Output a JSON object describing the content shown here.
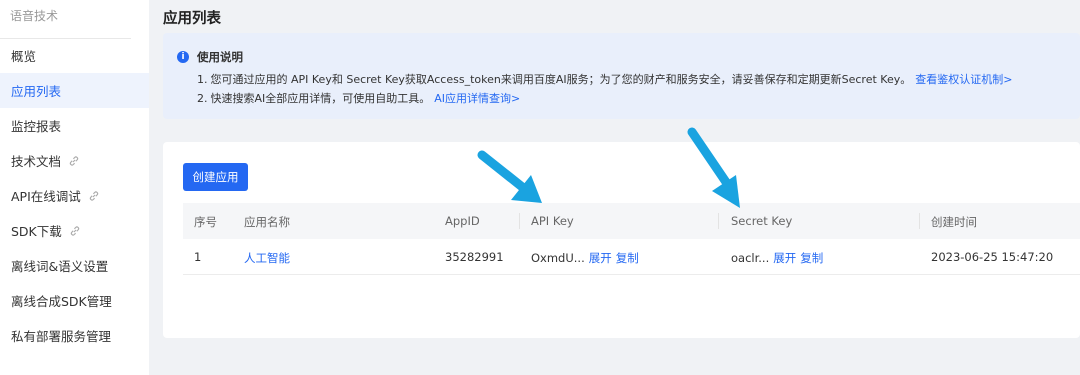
{
  "sidebar": {
    "header": "语音技术",
    "items": [
      {
        "label": "概览",
        "external": false,
        "active": false
      },
      {
        "label": "应用列表",
        "external": false,
        "active": true
      },
      {
        "label": "监控报表",
        "external": false,
        "active": false
      },
      {
        "label": "技术文档",
        "external": true,
        "active": false
      },
      {
        "label": "API在线调试",
        "external": true,
        "active": false
      },
      {
        "label": "SDK下载",
        "external": true,
        "active": false
      },
      {
        "label": "离线词&语义设置",
        "external": false,
        "active": false
      },
      {
        "label": "离线合成SDK管理",
        "external": false,
        "active": false
      },
      {
        "label": "私有部署服务管理",
        "external": false,
        "active": false
      }
    ]
  },
  "page_title": "应用列表",
  "notice": {
    "icon": "info-icon",
    "title": "使用说明",
    "line1": {
      "num": "1.",
      "text": "您可通过应用的 API Key和 Secret Key获取Access_token来调用百度AI服务；为了您的财产和服务安全，请妥善保存和定期更新Secret Key。",
      "link": "查看鉴权认证机制>"
    },
    "line2": {
      "num": "2.",
      "text": "快速搜索AI全部应用详情，可使用自助工具。",
      "link": "AI应用详情查询>"
    }
  },
  "create_button": "创建应用",
  "table": {
    "headers": [
      "序号",
      "应用名称",
      "AppID",
      "API Key",
      "Secret Key",
      "创建时间"
    ],
    "rows": [
      {
        "index": "1",
        "name": "人工智能",
        "appid": "35282991",
        "api_key": "OxmdU...",
        "secret_key": "oaclr...",
        "expand": "展开",
        "copy": "复制",
        "created": "2023-06-25 15:47:20"
      }
    ]
  },
  "colors": {
    "accent": "#2468f2",
    "arrow": "#1aa3e0",
    "active_bg": "#eef3fd"
  }
}
